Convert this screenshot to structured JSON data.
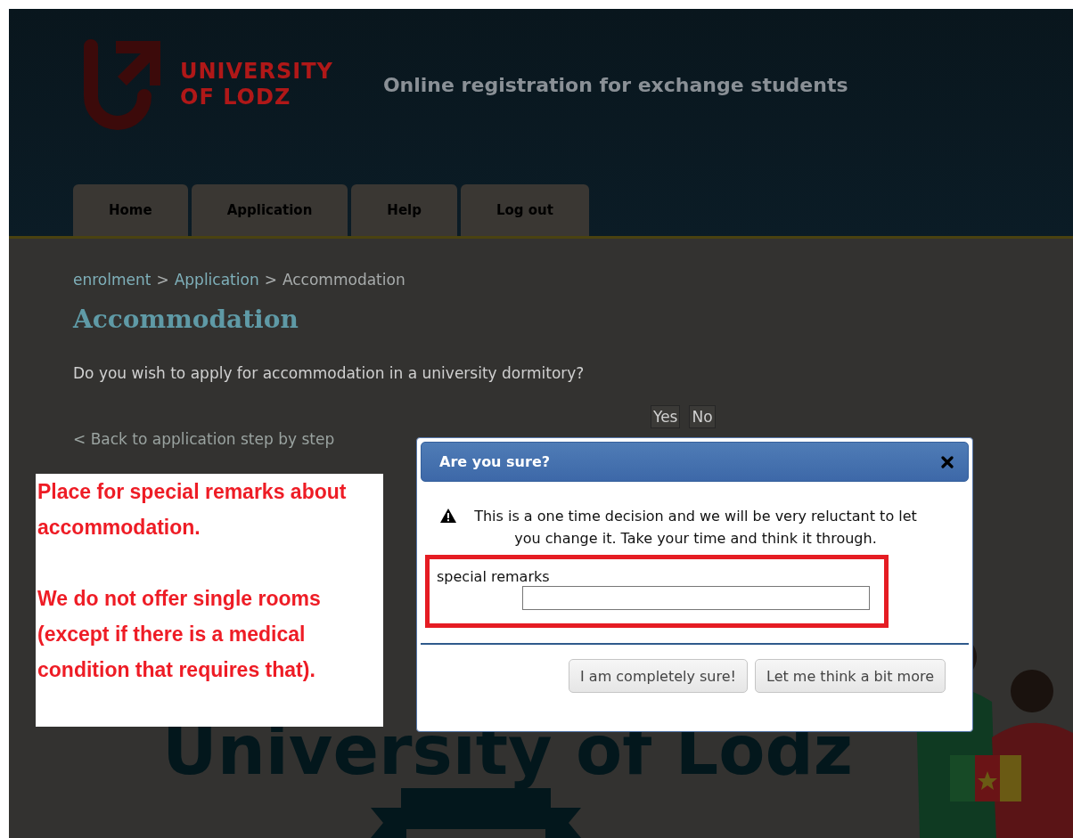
{
  "header": {
    "logo_lines": [
      "UNIVERSITY",
      "OF LODZ"
    ],
    "title": "Online registration for exchange students"
  },
  "tabs": [
    {
      "label": "Home"
    },
    {
      "label": "Application"
    },
    {
      "label": "Help"
    },
    {
      "label": "Log out"
    }
  ],
  "breadcrumb": {
    "separator": ">",
    "items": [
      {
        "label": "enrolment",
        "kind": "link"
      },
      {
        "label": "Application",
        "kind": "link"
      },
      {
        "label": "Accommodation",
        "kind": "current"
      }
    ]
  },
  "page": {
    "heading": "Accommodation",
    "question": "Do you wish to apply for accommodation in a university dormitory?",
    "choices": [
      "Yes",
      "No"
    ],
    "back_link": "< Back to application step by step",
    "banner_text": "University of Lodz"
  },
  "annotation": {
    "paragraphs": [
      "Place for special remarks about accommodation.",
      "We do not offer single rooms (except if there is a medical condition that requires that)."
    ]
  },
  "dialog": {
    "title": "Are you sure?",
    "message": "This is a one time decision and we will be very reluctant to let you change it. Take your time and think it through.",
    "field": {
      "label": "special remarks"
    },
    "buttons": [
      "I am completely sure!",
      "Let me think a bit more"
    ]
  }
}
